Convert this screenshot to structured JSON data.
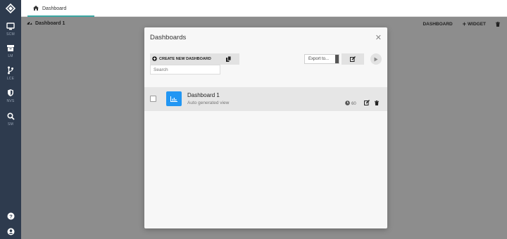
{
  "sidebar": {
    "items": [
      {
        "label": "SCM",
        "icon": "monitor-icon"
      },
      {
        "label": "LM",
        "icon": "archive-icon"
      },
      {
        "label": "LCE",
        "icon": "branch-icon"
      },
      {
        "label": "NVS",
        "icon": "shield-icon"
      },
      {
        "label": "SM",
        "icon": "search-icon"
      }
    ],
    "bottom": [
      {
        "icon": "help-icon"
      },
      {
        "icon": "user-icon"
      }
    ]
  },
  "topbar": {
    "tab_label": "Dashboard"
  },
  "subbar": {
    "breadcrumb": "Dashboard 1",
    "dashboard_label": "DASHBOARD",
    "widget_label": "WIDGET"
  },
  "modal": {
    "title": "Dashboards",
    "close": "✕",
    "create_label": "CREATE NEW DASHBOARD",
    "search_placeholder": "Search",
    "export_value": "Export to...",
    "rows": [
      {
        "title": "Dashboard 1",
        "subtitle": "Auto generated view",
        "views": "60"
      }
    ]
  },
  "colors": {
    "sidebar": "#2e3b4e",
    "accent_tab": "#3aa7a3",
    "row_icon": "#2196f3",
    "overlay": "#8d8d8d"
  }
}
